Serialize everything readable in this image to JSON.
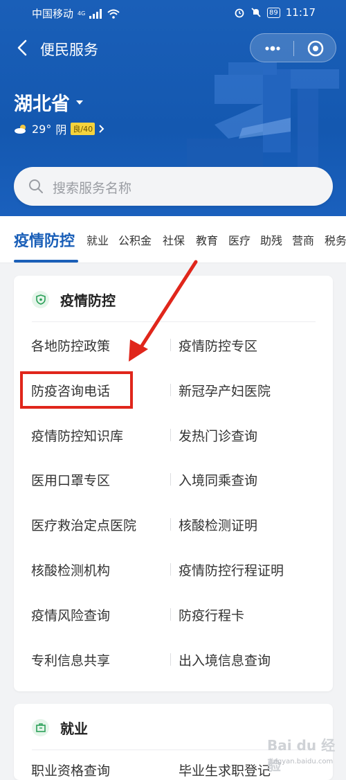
{
  "status_bar": {
    "carrier": "中国移动",
    "network": "4G",
    "battery": "89",
    "time": "11:17"
  },
  "navbar": {
    "title": "便民服务"
  },
  "location": {
    "province": "湖北省",
    "temperature": "29°",
    "condition": "阴",
    "aqi": "良/40"
  },
  "search": {
    "placeholder": "搜索服务名称"
  },
  "tabs": [
    "疫情防控",
    "就业",
    "公积金",
    "社保",
    "教育",
    "医疗",
    "助残",
    "营商",
    "税务"
  ],
  "sections": [
    {
      "title": "疫情防控",
      "items": [
        [
          "各地防控政策",
          "疫情防控专区"
        ],
        [
          "防疫咨询电话",
          "新冠孕产妇医院"
        ],
        [
          "疫情防控知识库",
          "发热门诊查询"
        ],
        [
          "医用口罩专区",
          "入境同乘查询"
        ],
        [
          "医疗救治定点医院",
          "核酸检测证明"
        ],
        [
          "核酸检测机构",
          "疫情防控行程证明"
        ],
        [
          "疫情风险查询",
          "防疫行程卡"
        ],
        [
          "专利信息共享",
          "出入境信息查询"
        ]
      ]
    },
    {
      "title": "就业",
      "items": [
        [
          "职业资格查询",
          "毕业生求职登记"
        ]
      ]
    }
  ],
  "watermark": {
    "brand": "Bai du 经验",
    "url": "jingyan.baidu.com"
  },
  "colors": {
    "primary": "#1a5fb8",
    "highlight": "#e0261b",
    "aqi_badge": "#f5d33d"
  }
}
